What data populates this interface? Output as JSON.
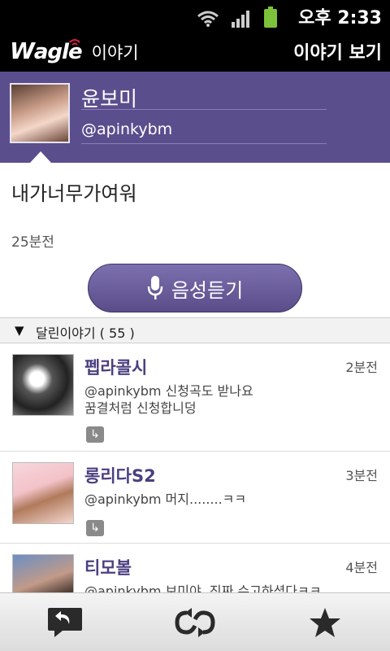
{
  "status_bar": {
    "time": "오후 2:33"
  },
  "app_bar": {
    "logo_text": "agle",
    "logo_sub": "이야기",
    "title": "이야기 보기"
  },
  "profile": {
    "name": "윤보미",
    "handle": "@apinkybm"
  },
  "post": {
    "text": "내가너무가여워",
    "time": "25분전",
    "voice_button_label": "음성듣기"
  },
  "replies_section": {
    "label": "달린이야기 ( 55 )"
  },
  "replies": [
    {
      "name": "펩라콜시",
      "time": "2분전",
      "text": "@apinkybm 신청곡도 받나요\n꿈결처럼 신청합니덩"
    },
    {
      "name": "롱리다S2",
      "time": "3분전",
      "text": "@apinkybm 머지........ㅋㅋ"
    },
    {
      "name": "티모볼",
      "time": "4분전",
      "text": "@apinkybm 보미야..진짜 수고하셨다ㅋㅋ"
    }
  ],
  "colors": {
    "accent": "#5b4e8d",
    "name_color": "#4b3f80"
  },
  "icons": [
    "wifi-icon",
    "signal-icon",
    "battery-icon",
    "microphone-icon",
    "reply-icon",
    "retweet-icon",
    "favorite-star-icon"
  ]
}
